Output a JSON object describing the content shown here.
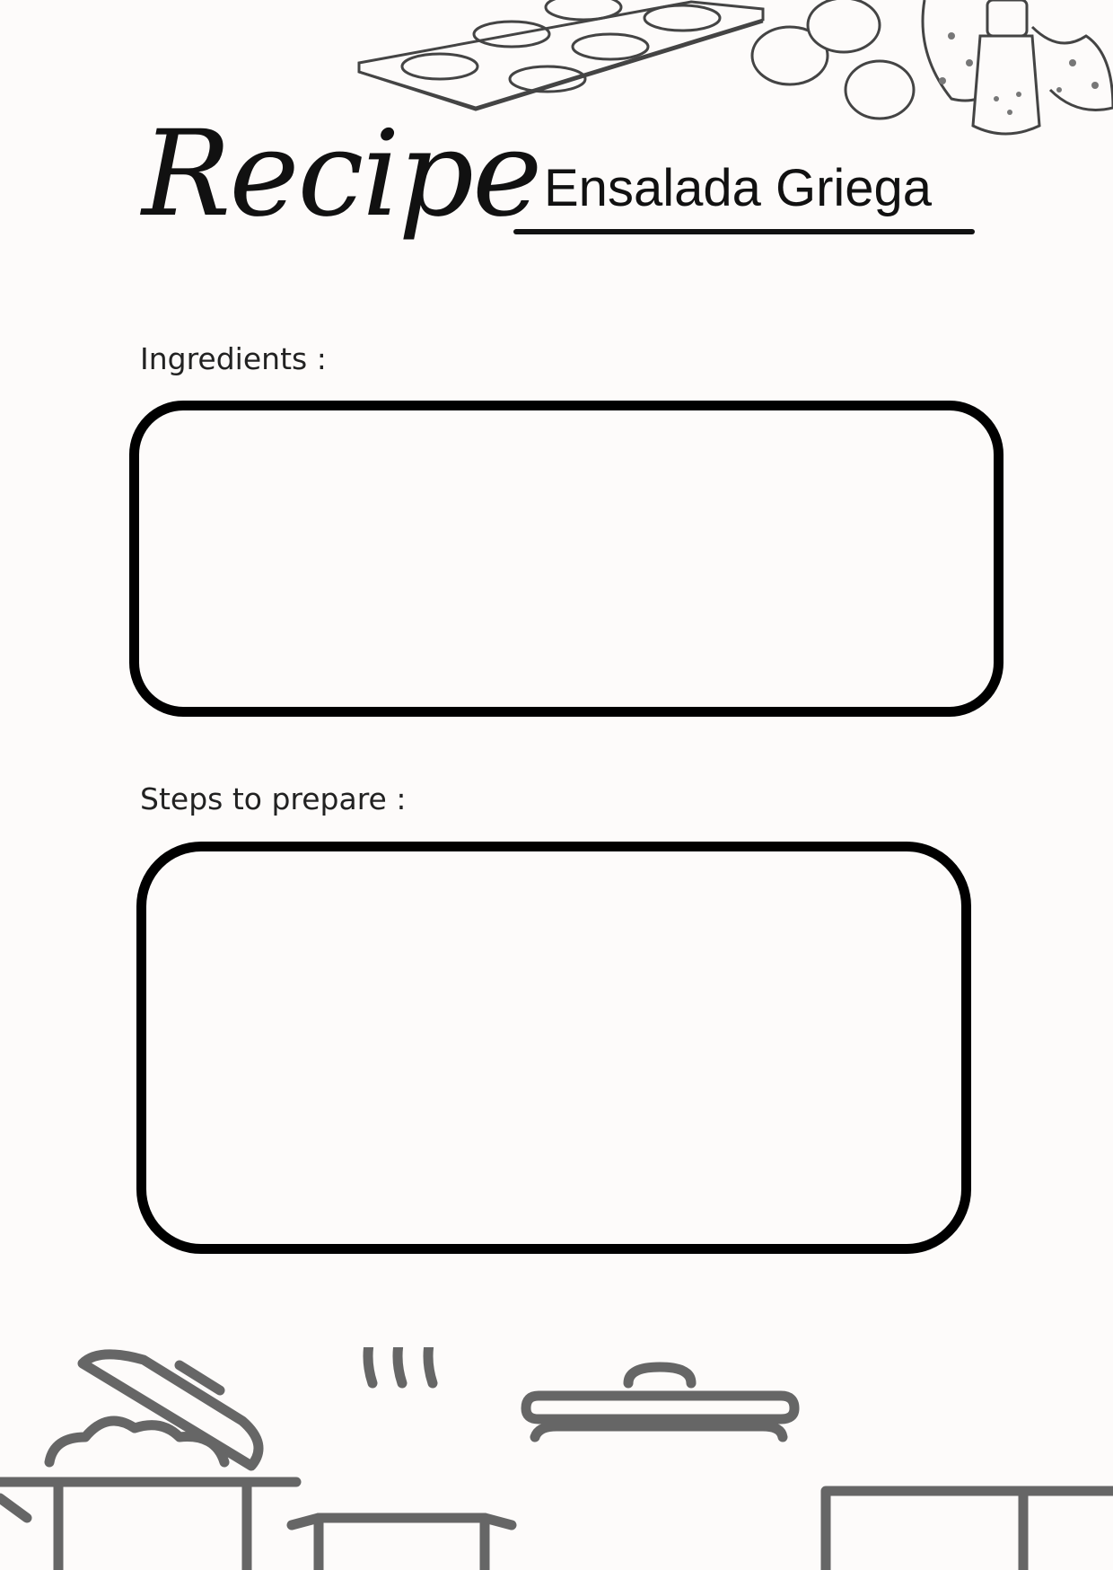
{
  "header": {
    "title": "Recipe",
    "dish_name": "Ensalada Griega"
  },
  "sections": {
    "ingredients": {
      "label": "Ingredients :"
    },
    "steps": {
      "label": "Steps to prepare :"
    }
  },
  "colors": {
    "ink": "#111111",
    "illustration": "#666666",
    "background": "#fdfbfa"
  },
  "icons": {
    "top": "baking-tray-eggs-illustration",
    "bottom": "cooking-pots-illustration"
  }
}
